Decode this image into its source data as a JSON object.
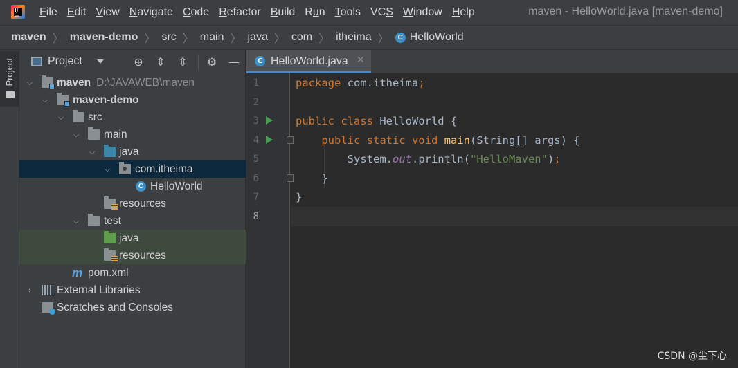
{
  "app": {
    "logo_icon": "intellij-idea-logo",
    "window_title": "maven - HelloWorld.java [maven-demo]"
  },
  "menu": [
    {
      "label": "File",
      "mnemonic": "F"
    },
    {
      "label": "Edit",
      "mnemonic": "E"
    },
    {
      "label": "View",
      "mnemonic": "V"
    },
    {
      "label": "Navigate",
      "mnemonic": "N"
    },
    {
      "label": "Code",
      "mnemonic": "C"
    },
    {
      "label": "Refactor",
      "mnemonic": "R"
    },
    {
      "label": "Build",
      "mnemonic": "B"
    },
    {
      "label": "Run",
      "mnemonic": "u"
    },
    {
      "label": "Tools",
      "mnemonic": "T"
    },
    {
      "label": "VCS",
      "mnemonic": "S"
    },
    {
      "label": "Window",
      "mnemonic": "W"
    },
    {
      "label": "Help",
      "mnemonic": "H"
    }
  ],
  "breadcrumb": [
    "maven",
    "maven-demo",
    "src",
    "main",
    "java",
    "com",
    "itheima",
    "HelloWorld"
  ],
  "tool_strip": {
    "project_label": "Project"
  },
  "project_panel": {
    "title": "Project",
    "tree": [
      {
        "label": "maven",
        "sub": "D:\\JAVAWEB\\maven",
        "depth": 0,
        "expanded": true,
        "icon": "module-folder",
        "bold": true
      },
      {
        "label": "maven-demo",
        "depth": 1,
        "expanded": true,
        "icon": "module-folder",
        "bold": true
      },
      {
        "label": "src",
        "depth": 2,
        "expanded": true,
        "icon": "folder"
      },
      {
        "label": "main",
        "depth": 3,
        "expanded": true,
        "icon": "folder"
      },
      {
        "label": "java",
        "depth": 4,
        "expanded": true,
        "icon": "source-folder"
      },
      {
        "label": "com.itheima",
        "depth": 5,
        "expanded": true,
        "icon": "package",
        "selected": true
      },
      {
        "label": "HelloWorld",
        "depth": 6,
        "icon": "class"
      },
      {
        "label": "resources",
        "depth": 4,
        "icon": "resources-folder"
      },
      {
        "label": "test",
        "depth": 3,
        "expanded": true,
        "icon": "folder"
      },
      {
        "label": "java",
        "depth": 4,
        "icon": "test-source-folder",
        "highlight": true
      },
      {
        "label": "resources",
        "depth": 4,
        "icon": "test-resources-folder",
        "highlight": true
      },
      {
        "label": "pom.xml",
        "depth": 2,
        "icon": "maven-file"
      },
      {
        "label": "External Libraries",
        "depth": 0,
        "collapsed": true,
        "icon": "libraries"
      },
      {
        "label": "Scratches and Consoles",
        "depth": 0,
        "icon": "scratches"
      }
    ]
  },
  "editor": {
    "tab_label": "HelloWorld.java",
    "line_numbers": [
      "1",
      "2",
      "3",
      "4",
      "5",
      "6",
      "7",
      "8"
    ],
    "current_line": "8"
  },
  "watermark": "CSDN @尘下心"
}
